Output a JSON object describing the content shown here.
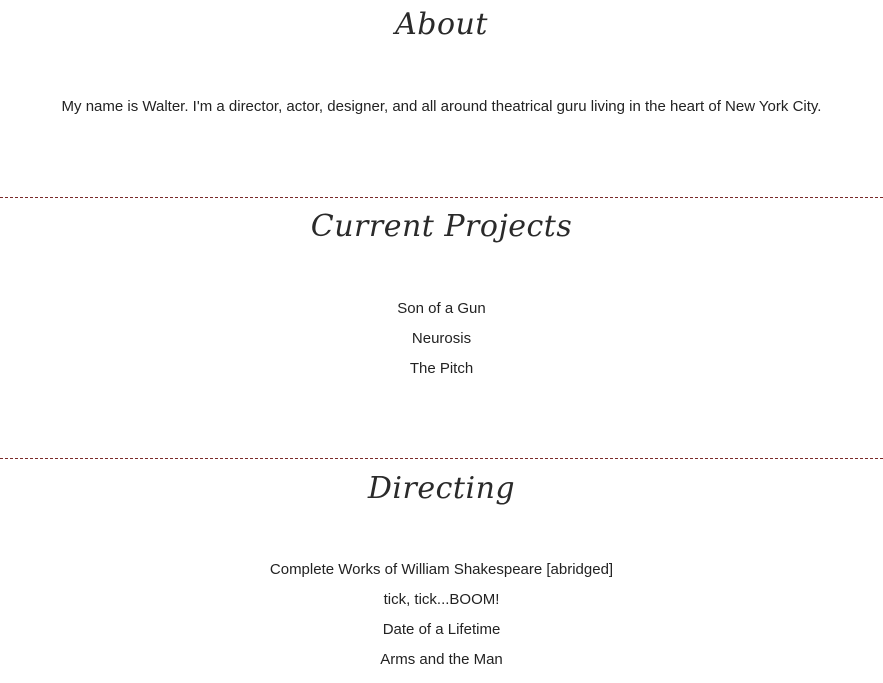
{
  "about": {
    "heading": "About",
    "text": "My name is Walter. I'm a director, actor, designer, and all around theatrical guru living in the heart of New York City."
  },
  "current_projects": {
    "heading": "Current Projects",
    "items": [
      "Son of a Gun",
      "Neurosis",
      "The Pitch"
    ]
  },
  "directing": {
    "heading": "Directing",
    "items": [
      "Complete Works of William Shakespeare [abridged]",
      "tick, tick...BOOM!",
      "Date of a Lifetime",
      "Arms and the Man"
    ]
  },
  "colors": {
    "divider": "#7a2a2a",
    "text": "#222222"
  }
}
